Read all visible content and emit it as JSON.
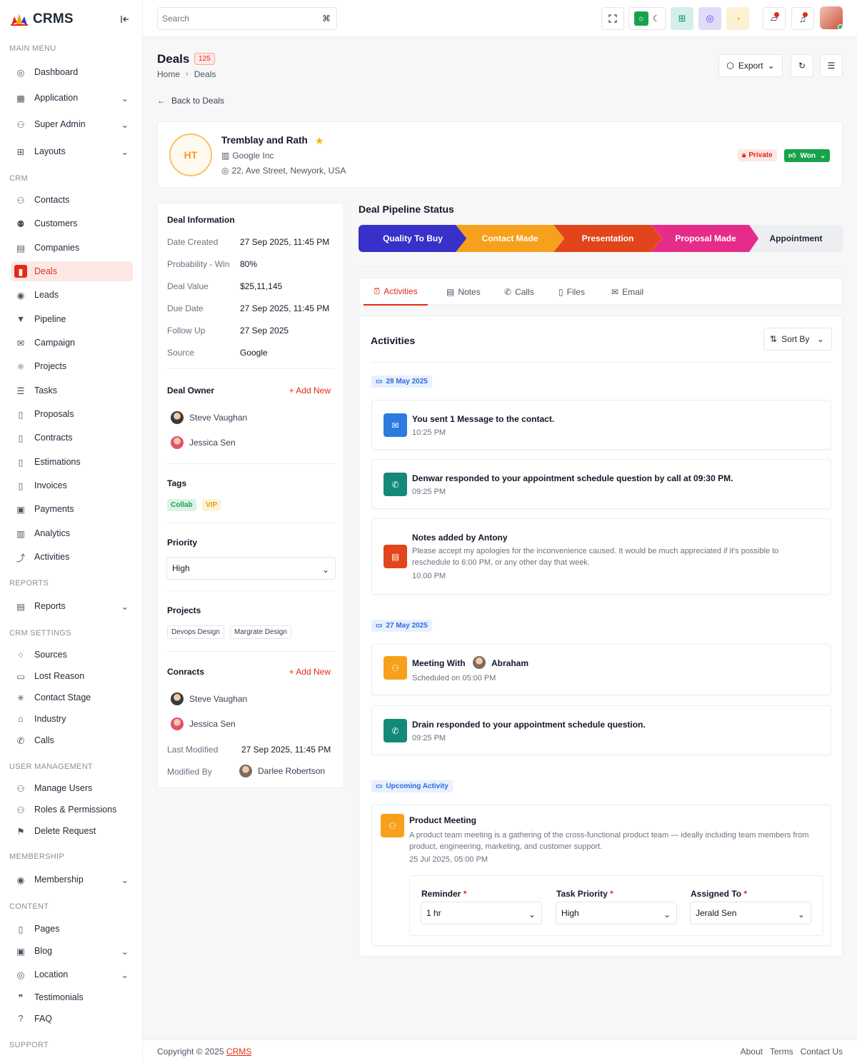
{
  "brand": {
    "name": "CRMS"
  },
  "sidebar": {
    "sections": {
      "main": "MAIN MENU",
      "crm": "CRM",
      "reports": "REPORTS",
      "crm_settings": "CRM SETTINGS",
      "user_management": "USER MANAGEMENT",
      "membership": "MEMBERSHIP",
      "content": "CONTENT",
      "support": "SUPPORT"
    },
    "items": {
      "dashboard": "Dashboard",
      "application": "Application",
      "super_admin": "Super Admin",
      "layouts": "Layouts",
      "contacts": "Contacts",
      "customers": "Customers",
      "companies": "Companies",
      "deals": "Deals",
      "leads": "Leads",
      "pipeline": "Pipeline",
      "campaign": "Campaign",
      "projects": "Projects",
      "tasks": "Tasks",
      "proposals": "Proposals",
      "contracts": "Contracts",
      "estimations": "Estimations",
      "invoices": "Invoices",
      "payments": "Payments",
      "analytics": "Analytics",
      "activities": "Activities",
      "reports": "Reports",
      "sources": "Sources",
      "lost_reason": "Lost Reason",
      "contact_stage": "Contact Stage",
      "industry": "Industry",
      "calls": "Calls",
      "manage_users": "Manage Users",
      "roles_permissions": "Roles & Permissions",
      "delete_request": "Delete Request",
      "membership": "Membership",
      "pages": "Pages",
      "blog": "Blog",
      "location": "Location",
      "testimonials": "Testimonials",
      "faq": "FAQ"
    }
  },
  "topbar": {
    "search_placeholder": "Search",
    "search_shortcut": "⌘"
  },
  "page": {
    "title": "Deals",
    "count": "125",
    "breadcrumb": {
      "home": "Home",
      "current": "Deals"
    },
    "export_label": "Export",
    "back_label": "Back to Deals"
  },
  "deal": {
    "initials": "HT",
    "name": "Tremblay and Rath",
    "company": "Google Inc",
    "address": "22, Ave Street, Newyork, USA",
    "privacy": "Private",
    "status": "Won"
  },
  "info": {
    "title": "Deal Information",
    "rows": [
      {
        "label": "Date Created",
        "value": "27 Sep 2025, 11:45 PM"
      },
      {
        "label": "Probability - Win",
        "value": "80%"
      },
      {
        "label": "Deal Value",
        "value": "$25,11,145"
      },
      {
        "label": "Due Date",
        "value": "27 Sep 2025, 11:45 PM"
      },
      {
        "label": "Follow Up",
        "value": "27 Sep 2025"
      },
      {
        "label": "Source",
        "value": "Google"
      }
    ],
    "owner_title": "Deal Owner",
    "add_new": "Add New",
    "owners": [
      "Steve Vaughan",
      "Jessica Sen"
    ],
    "tags_title": "Tags",
    "tags": [
      "Collab",
      "VIP"
    ],
    "priority_title": "Priority",
    "priority_value": "High",
    "projects_title": "Projects",
    "projects": [
      "Devops Design",
      "Margrate Design"
    ],
    "contracts_title": "Conracts",
    "contracts": [
      "Steve Vaughan",
      "Jessica Sen"
    ],
    "last_modified_label": "Last Modified",
    "last_modified_value": "27 Sep 2025, 11:45 PM",
    "modified_by_label": "Modified By",
    "modified_by_value": "Darlee Robertson"
  },
  "pipeline": {
    "title": "Deal Pipeline Status",
    "steps": [
      {
        "label": "Quality To Buy",
        "color": "#3730c9"
      },
      {
        "label": "Contact Made",
        "color": "#f7a01c"
      },
      {
        "label": "Presentation",
        "color": "#e2451b"
      },
      {
        "label": "Proposal Made",
        "color": "#e72b8a"
      },
      {
        "label": "Appointment",
        "color": "#eceef1"
      }
    ]
  },
  "tabs": [
    "Activities",
    "Notes",
    "Calls",
    "Files",
    "Email"
  ],
  "activities": {
    "title": "Activities",
    "sort_label": "Sort By",
    "groups": [
      {
        "date": "28 May 2025",
        "items": [
          {
            "icon": "mail-icon",
            "color": "#2d7be0",
            "text": "You sent 1 Message to the contact.",
            "time": "10:25 PM"
          },
          {
            "icon": "phone-icon",
            "color": "#14897a",
            "text": "Denwar responded to your appointment schedule question by call at 09:30 PM.",
            "time": "09:25 PM"
          },
          {
            "icon": "note-icon",
            "color": "#e2451b",
            "text": "Notes added by Antony",
            "desc": "Please accept my apologies for the inconvenience caused. It would be much appreciated if it's possible to reschedule to 6:00 PM, or any other day that week.",
            "time": "10.00 PM"
          }
        ]
      },
      {
        "date": "27 May 2025",
        "items": [
          {
            "icon": "user-icon",
            "color": "#f7a01c",
            "text": "Meeting With",
            "person": "Abraham",
            "time_label": "Scheduled on 05:00 PM"
          },
          {
            "icon": "phone-icon",
            "color": "#14897a",
            "text": "Drain responded to your appointment schedule question.",
            "time": "09:25 PM"
          }
        ]
      }
    ],
    "upcoming": {
      "label": "Upcoming Activity",
      "title": "Product Meeting",
      "desc": "A product team meeting is a gathering of the cross-functional product team — ideally including team members from product, engineering, marketing, and customer support.",
      "time": "25 Jul 2025, 05:00 PM",
      "fields": [
        {
          "label": "Reminder",
          "value": "1 hr"
        },
        {
          "label": "Task Priority",
          "value": "High"
        },
        {
          "label": "Assigned To",
          "value": "Jerald Sen"
        }
      ]
    }
  },
  "footer": {
    "copyright": "Copyright © 2025",
    "brand_link": "CRMS",
    "links": [
      "About",
      "Terms",
      "Contact Us"
    ]
  }
}
